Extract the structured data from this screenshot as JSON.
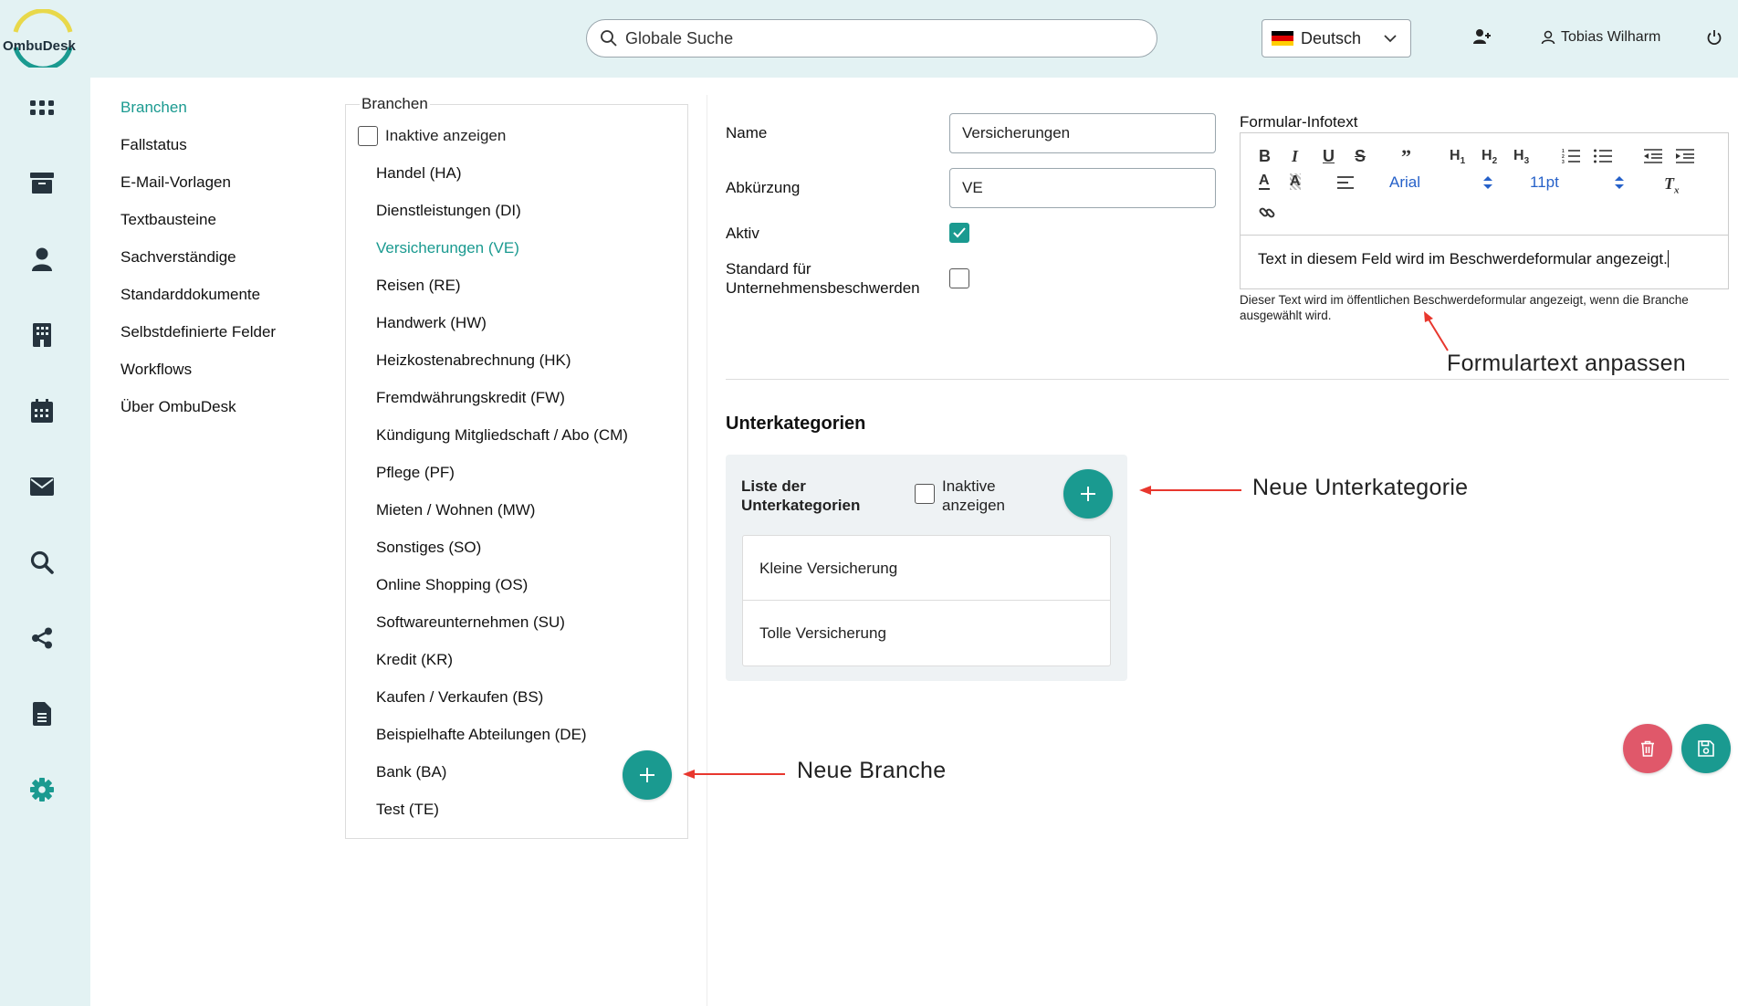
{
  "app": {
    "logo_text": "OmbuDesk"
  },
  "header": {
    "search_placeholder": "Globale Suche",
    "language": "Deutsch",
    "user_name": "Tobias Wilharm"
  },
  "sidebar_icons": [
    "apps-icon",
    "archive-icon",
    "person-icon",
    "building-icon",
    "calendar-icon",
    "mail-icon",
    "search-icon",
    "share-icon",
    "document-icon",
    "settings-icon"
  ],
  "subnav": {
    "items": [
      "Branchen",
      "Fallstatus",
      "E-Mail-Vorlagen",
      "Textbausteine",
      "Sachverständige",
      "Standarddokumente",
      "Selbstdefinierte Felder",
      "Workflows",
      "Über OmbuDesk"
    ],
    "active_index": 0
  },
  "branches": {
    "title": "Branchen",
    "inactive_label": "Inaktive anzeigen",
    "items": [
      "Handel (HA)",
      "Dienstleistungen (DI)",
      "Versicherungen (VE)",
      "Reisen (RE)",
      "Handwerk (HW)",
      "Heizkostenabrechnung (HK)",
      "Fremdwährungskredit (FW)",
      "Kündigung Mitgliedschaft / Abo (CM)",
      "Pflege (PF)",
      "Mieten / Wohnen (MW)",
      "Sonstiges (SO)",
      "Online Shopping (OS)",
      "Softwareunternehmen (SU)",
      "Kredit (KR)",
      "Kaufen / Verkaufen (BS)",
      "Beispielhafte Abteilungen (DE)",
      "Bank (BA)",
      "Test (TE)"
    ],
    "active_index": 2
  },
  "detail": {
    "name_label": "Name",
    "name_value": "Versicherungen",
    "abbr_label": "Abkürzung",
    "abbr_value": "VE",
    "active_label": "Aktiv",
    "active_checked": true,
    "standard_label_1": "Standard für",
    "standard_label_2": "Unternehmensbeschwerden",
    "standard_checked": false,
    "infotext_label": "Formular-Infotext",
    "editor": {
      "font": "Arial",
      "size": "11pt",
      "content": "Text in diesem Feld wird im Beschwerdeformular angezeigt."
    },
    "hint": "Dieser Text wird im öffentlichen Beschwerdeformular angezeigt, wenn die Branche ausgewählt wird."
  },
  "subcategories": {
    "title": "Unterkategorien",
    "list_title": "Liste der Unterkategorien",
    "inactive_label": "Inaktive anzeigen",
    "items": [
      "Kleine Versicherung",
      "Tolle Versicherung"
    ]
  },
  "annotations": {
    "form_text": "Formulartext anpassen",
    "new_subcategory": "Neue Unterkategorie",
    "new_branch": "Neue Branche"
  },
  "colors": {
    "accent": "#1a9a90",
    "danger": "#e0586a",
    "sidebar_bg": "#e3f2f3",
    "annotation_arrow": "#e8372e"
  }
}
